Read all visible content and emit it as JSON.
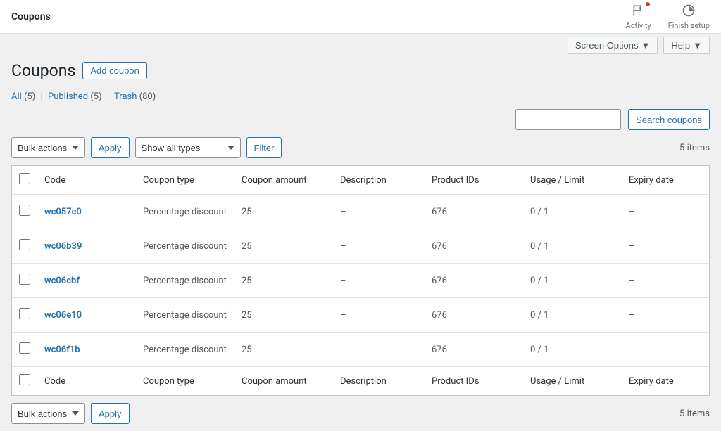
{
  "topbar": {
    "title": "Coupons",
    "activity": "Activity",
    "finish_setup": "Finish setup"
  },
  "screen_options": "Screen Options",
  "help": "Help",
  "page_title": "Coupons",
  "add_coupon": "Add coupon",
  "filter_links": {
    "all": {
      "label": "All",
      "count": "(5)"
    },
    "published": {
      "label": "Published",
      "count": "(5)"
    },
    "trash": {
      "label": "Trash",
      "count": "(80)"
    }
  },
  "bulk_actions": "Bulk actions",
  "apply": "Apply",
  "show_all_types": "Show all types",
  "filter": "Filter",
  "search_coupons": "Search coupons",
  "items_label": "5 items",
  "columns": {
    "code": "Code",
    "type": "Coupon type",
    "amount": "Coupon amount",
    "description": "Description",
    "product_ids": "Product IDs",
    "usage": "Usage / Limit",
    "expiry": "Expiry date"
  },
  "rows": [
    {
      "code": "wc057c0",
      "type": "Percentage discount",
      "amount": "25",
      "description": "–",
      "product_ids": "676",
      "usage": "0 / 1",
      "expiry": "–"
    },
    {
      "code": "wc06b39",
      "type": "Percentage discount",
      "amount": "25",
      "description": "–",
      "product_ids": "676",
      "usage": "0 / 1",
      "expiry": "–"
    },
    {
      "code": "wc06cbf",
      "type": "Percentage discount",
      "amount": "25",
      "description": "–",
      "product_ids": "676",
      "usage": "0 / 1",
      "expiry": "–"
    },
    {
      "code": "wc06e10",
      "type": "Percentage discount",
      "amount": "25",
      "description": "–",
      "product_ids": "676",
      "usage": "0 / 1",
      "expiry": "–"
    },
    {
      "code": "wc06f1b",
      "type": "Percentage discount",
      "amount": "25",
      "description": "–",
      "product_ids": "676",
      "usage": "0 / 1",
      "expiry": "–"
    }
  ]
}
